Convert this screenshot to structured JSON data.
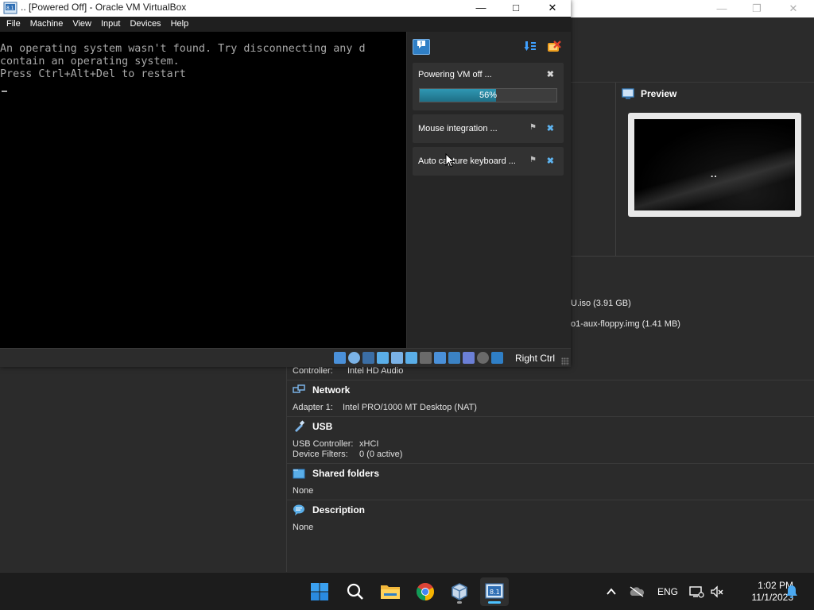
{
  "vm_window": {
    "title": ".. [Powered Off] - Oracle VM VirtualBox",
    "menu": [
      "File",
      "Machine",
      "View",
      "Input",
      "Devices",
      "Help"
    ],
    "console_lines": [
      "An operating system wasn't found. Try disconnecting any d",
      "contain an operating system.",
      "Press Ctrl+Alt+Del to restart"
    ],
    "notifications": {
      "powering": {
        "label": "Powering VM off ...",
        "progress": 56,
        "progress_label": "56%"
      },
      "mouse": {
        "label": "Mouse integration ..."
      },
      "keyboard": {
        "label": "Auto capture keyboard ..."
      }
    },
    "status": {
      "host_key": "Right Ctrl"
    }
  },
  "manager": {
    "preview_label": "Preview",
    "storage": [
      "U.iso (3.91 GB)",
      "o1-aux-floppy.img (1.41 MB)"
    ],
    "audio": {
      "controller_key": "Controller:",
      "controller_value": "Intel HD Audio"
    },
    "network": {
      "title": "Network",
      "adapter_key": "Adapter 1:",
      "adapter_value": "Intel PRO/1000 MT Desktop (NAT)"
    },
    "usb": {
      "title": "USB",
      "controller_key": "USB Controller:",
      "controller_value": "xHCI",
      "filters_key": "Device Filters:",
      "filters_value": "0 (0 active)"
    },
    "shared": {
      "title": "Shared folders",
      "value": "None"
    },
    "description": {
      "title": "Description",
      "value": "None"
    }
  },
  "taskbar": {
    "language": "ENG",
    "time": "1:02 PM",
    "date": "11/1/2023"
  },
  "colors": {
    "accent": "#2f7fc6",
    "progress": "#1f7f98",
    "taskbar": "#1c1c1c",
    "manager_bg": "#2b2b2b"
  },
  "icons": [
    "windows-start-icon",
    "search-icon",
    "file-explorer-icon",
    "chrome-icon",
    "virtualbox-icon",
    "vm-running-icon",
    "chevron-up-icon",
    "cloud-offline-icon",
    "network-icon",
    "volume-muted-icon",
    "bell-icon"
  ]
}
